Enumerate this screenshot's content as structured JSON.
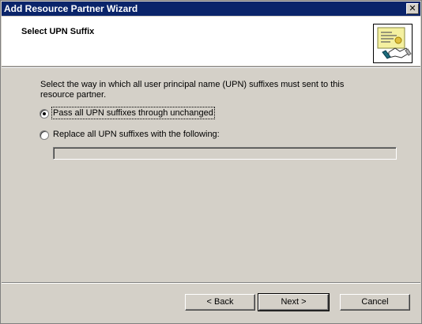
{
  "window": {
    "title": "Add Resource Partner Wizard",
    "close_glyph": "✕"
  },
  "header": {
    "title": "Select UPN Suffix",
    "icon": "wizard-handshake-certificate-icon"
  },
  "content": {
    "description": "Select the way in which all user principal name (UPN) suffixes must sent to this resource partner.",
    "options": [
      {
        "label": "Pass all UPN suffixes through unchanged",
        "selected": true
      },
      {
        "label": "Replace all UPN suffixes with the following:",
        "selected": false
      }
    ],
    "replacement_field": {
      "value": "",
      "enabled": false
    }
  },
  "buttons": {
    "back": "< Back",
    "next": "Next >",
    "cancel": "Cancel"
  },
  "colors": {
    "titlebar": "#0a246a",
    "dialog_face": "#d4d0c8",
    "header_bg": "#ffffff"
  }
}
